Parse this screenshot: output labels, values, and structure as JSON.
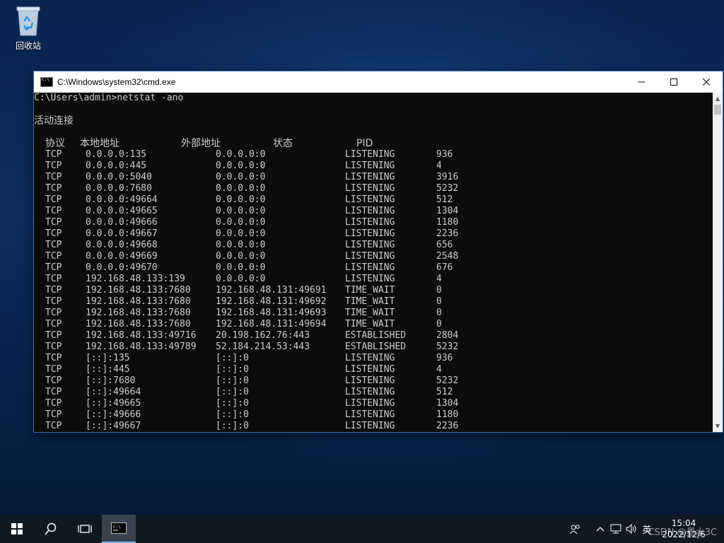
{
  "desktop": {
    "recycle_bin_label": "回收站"
  },
  "window": {
    "title": "C:\\Windows\\system32\\cmd.exe",
    "command_line": "C:\\Users\\admin>netstat -ano",
    "section_title": "活动连接",
    "headers": [
      "协议",
      "本地地址",
      "外部地址",
      "状态",
      "PID"
    ],
    "rows": [
      [
        "TCP",
        "0.0.0.0:135",
        "0.0.0.0:0",
        "LISTENING",
        "936"
      ],
      [
        "TCP",
        "0.0.0.0:445",
        "0.0.0.0:0",
        "LISTENING",
        "4"
      ],
      [
        "TCP",
        "0.0.0.0:5040",
        "0.0.0.0:0",
        "LISTENING",
        "3916"
      ],
      [
        "TCP",
        "0.0.0.0:7680",
        "0.0.0.0:0",
        "LISTENING",
        "5232"
      ],
      [
        "TCP",
        "0.0.0.0:49664",
        "0.0.0.0:0",
        "LISTENING",
        "512"
      ],
      [
        "TCP",
        "0.0.0.0:49665",
        "0.0.0.0:0",
        "LISTENING",
        "1304"
      ],
      [
        "TCP",
        "0.0.0.0:49666",
        "0.0.0.0:0",
        "LISTENING",
        "1180"
      ],
      [
        "TCP",
        "0.0.0.0:49667",
        "0.0.0.0:0",
        "LISTENING",
        "2236"
      ],
      [
        "TCP",
        "0.0.0.0:49668",
        "0.0.0.0:0",
        "LISTENING",
        "656"
      ],
      [
        "TCP",
        "0.0.0.0:49669",
        "0.0.0.0:0",
        "LISTENING",
        "2548"
      ],
      [
        "TCP",
        "0.0.0.0:49670",
        "0.0.0.0:0",
        "LISTENING",
        "676"
      ],
      [
        "TCP",
        "192.168.48.133:139",
        "0.0.0.0:0",
        "LISTENING",
        "4"
      ],
      [
        "TCP",
        "192.168.48.133:7680",
        "192.168.48.131:49691",
        "TIME_WAIT",
        "0"
      ],
      [
        "TCP",
        "192.168.48.133:7680",
        "192.168.48.131:49692",
        "TIME_WAIT",
        "0"
      ],
      [
        "TCP",
        "192.168.48.133:7680",
        "192.168.48.131:49693",
        "TIME_WAIT",
        "0"
      ],
      [
        "TCP",
        "192.168.48.133:7680",
        "192.168.48.131:49694",
        "TIME_WAIT",
        "0"
      ],
      [
        "TCP",
        "192.168.48.133:49716",
        "20.198.162.76:443",
        "ESTABLISHED",
        "2804"
      ],
      [
        "TCP",
        "192.168.48.133:49789",
        "52.184.214.53:443",
        "ESTABLISHED",
        "5232"
      ],
      [
        "TCP",
        "[::]:135",
        "[::]:0",
        "LISTENING",
        "936"
      ],
      [
        "TCP",
        "[::]:445",
        "[::]:0",
        "LISTENING",
        "4"
      ],
      [
        "TCP",
        "[::]:7680",
        "[::]:0",
        "LISTENING",
        "5232"
      ],
      [
        "TCP",
        "[::]:49664",
        "[::]:0",
        "LISTENING",
        "512"
      ],
      [
        "TCP",
        "[::]:49665",
        "[::]:0",
        "LISTENING",
        "1304"
      ],
      [
        "TCP",
        "[::]:49666",
        "[::]:0",
        "LISTENING",
        "1180"
      ],
      [
        "TCP",
        "[::]:49667",
        "[::]:0",
        "LISTENING",
        "2236"
      ]
    ]
  },
  "taskbar": {
    "ime_label": "英",
    "clock_time": "15:04",
    "clock_date": "2022/12/6"
  },
  "watermark": "CSDN @墨水3C"
}
